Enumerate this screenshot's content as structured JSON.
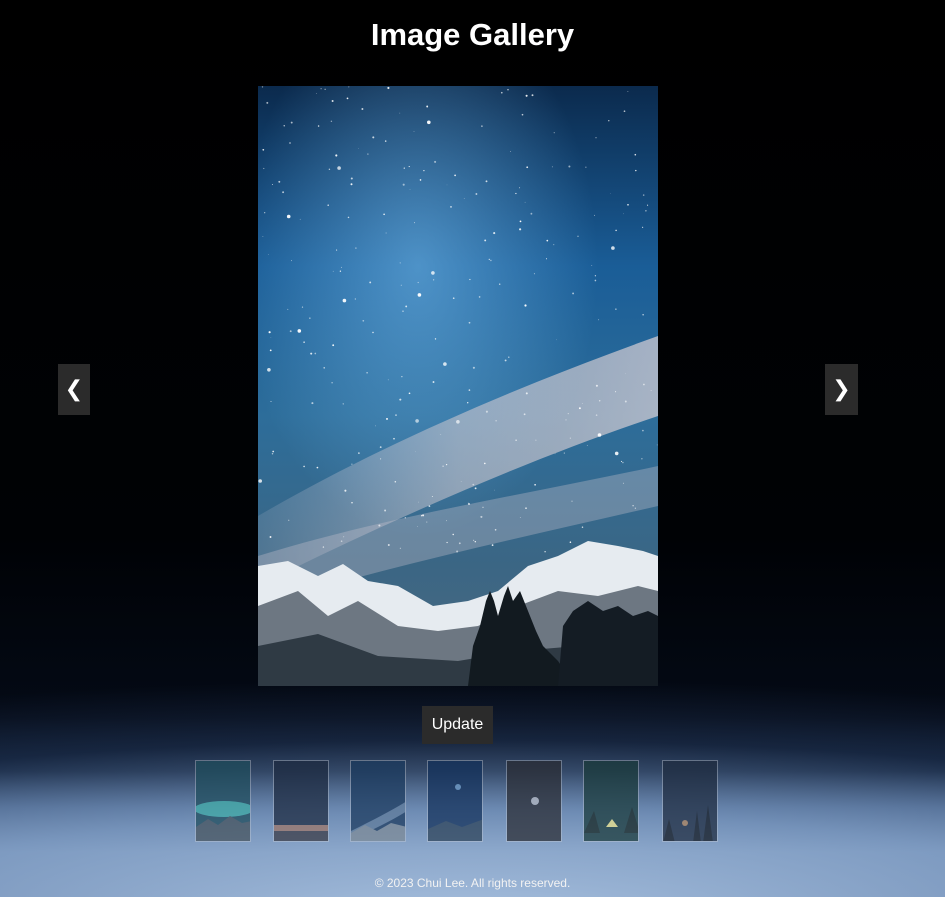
{
  "page": {
    "title": "Image Gallery",
    "footer_text": "© 2023 Chui Lee. All rights reserved."
  },
  "gallery": {
    "prev_label": "❮",
    "next_label": "❯",
    "update_label": "Update",
    "main_image": {
      "icon": "starry-night-mountains-image"
    },
    "thumbnails": [
      {
        "icon": "aurora-mountain-thumbnail",
        "sky": "#1f4d5c",
        "glow": "#4fd6c8"
      },
      {
        "icon": "night-sky-road-thumbnail",
        "sky": "#1d2a40",
        "glow": "#c08a70"
      },
      {
        "icon": "milky-way-mountains-thumbnail",
        "sky": "#1b3a5e",
        "glow": "#8fa9c4"
      },
      {
        "icon": "starry-sky-hills-thumbnail",
        "sky": "#12305a",
        "glow": "#6f9cc8"
      },
      {
        "icon": "moon-dark-sky-thumbnail",
        "sky": "#2a2c33",
        "glow": "#b9bcc4"
      },
      {
        "icon": "tent-under-stars-thumbnail",
        "sky": "#1a3a3a",
        "glow": "#f2e88a"
      },
      {
        "icon": "forest-night-sky-thumbnail",
        "sky": "#1f2c40",
        "glow": "#d39a60"
      }
    ]
  }
}
